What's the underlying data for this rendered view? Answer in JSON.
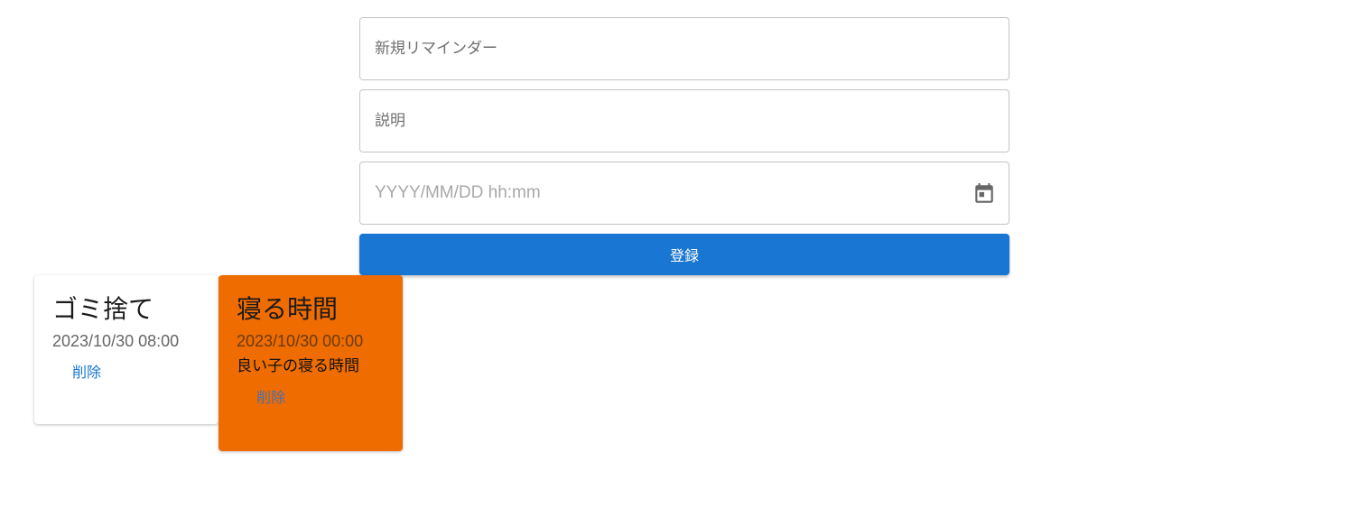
{
  "form": {
    "title_placeholder": "新規リマインダー",
    "description_placeholder": "説明",
    "datetime_placeholder": "YYYY/MM/DD hh:mm",
    "submit_label": "登録",
    "accent_color": "#1976d2"
  },
  "reminders": [
    {
      "title": "ゴミ捨て",
      "datetime": "2023/10/30 08:00",
      "description": "",
      "delete_label": "削除",
      "background": "#ffffff"
    },
    {
      "title": "寝る時間",
      "datetime": "2023/10/30 00:00",
      "description": "良い子の寝る時間",
      "delete_label": "削除",
      "background": "#ef6c00"
    }
  ]
}
